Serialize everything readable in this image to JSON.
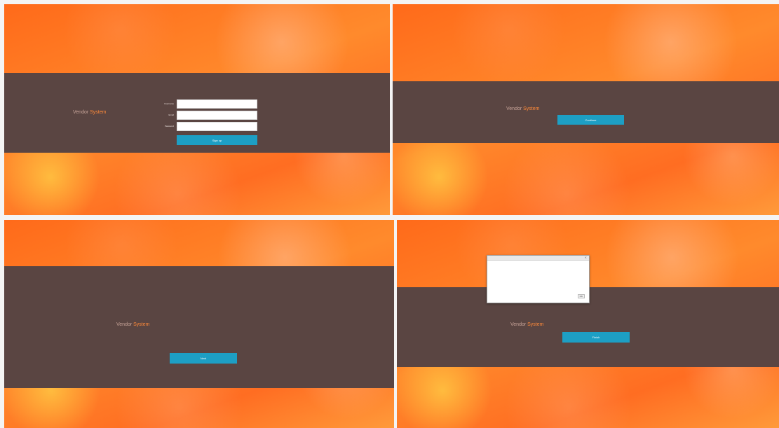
{
  "panels": [
    {
      "logo": {
        "name": "Vendor",
        "accent": "System"
      },
      "heading": "",
      "fields": [
        {
          "label": "Username",
          "value": ""
        },
        {
          "label": "Email",
          "value": ""
        },
        {
          "label": "Password",
          "value": ""
        }
      ],
      "button": "Sign up"
    },
    {
      "logo": {
        "name": "Vendor",
        "accent": "System"
      },
      "button": "Continue"
    },
    {
      "logo": {
        "name": "Vendor",
        "accent": "System"
      },
      "button": "Next",
      "footer_link": ""
    },
    {
      "logo": {
        "name": "Vendor",
        "accent": "System"
      },
      "dialog": {
        "title": "",
        "lines": [
          "",
          "",
          "",
          "",
          ""
        ],
        "button": "OK"
      },
      "button": "Finish",
      "footer_link": ""
    }
  ],
  "colors": {
    "background_orange": "#ff7a28",
    "band": "#5a4542",
    "button": "#1d9fc4",
    "accent": "#ff8a3a",
    "link": "#29b5e0"
  }
}
